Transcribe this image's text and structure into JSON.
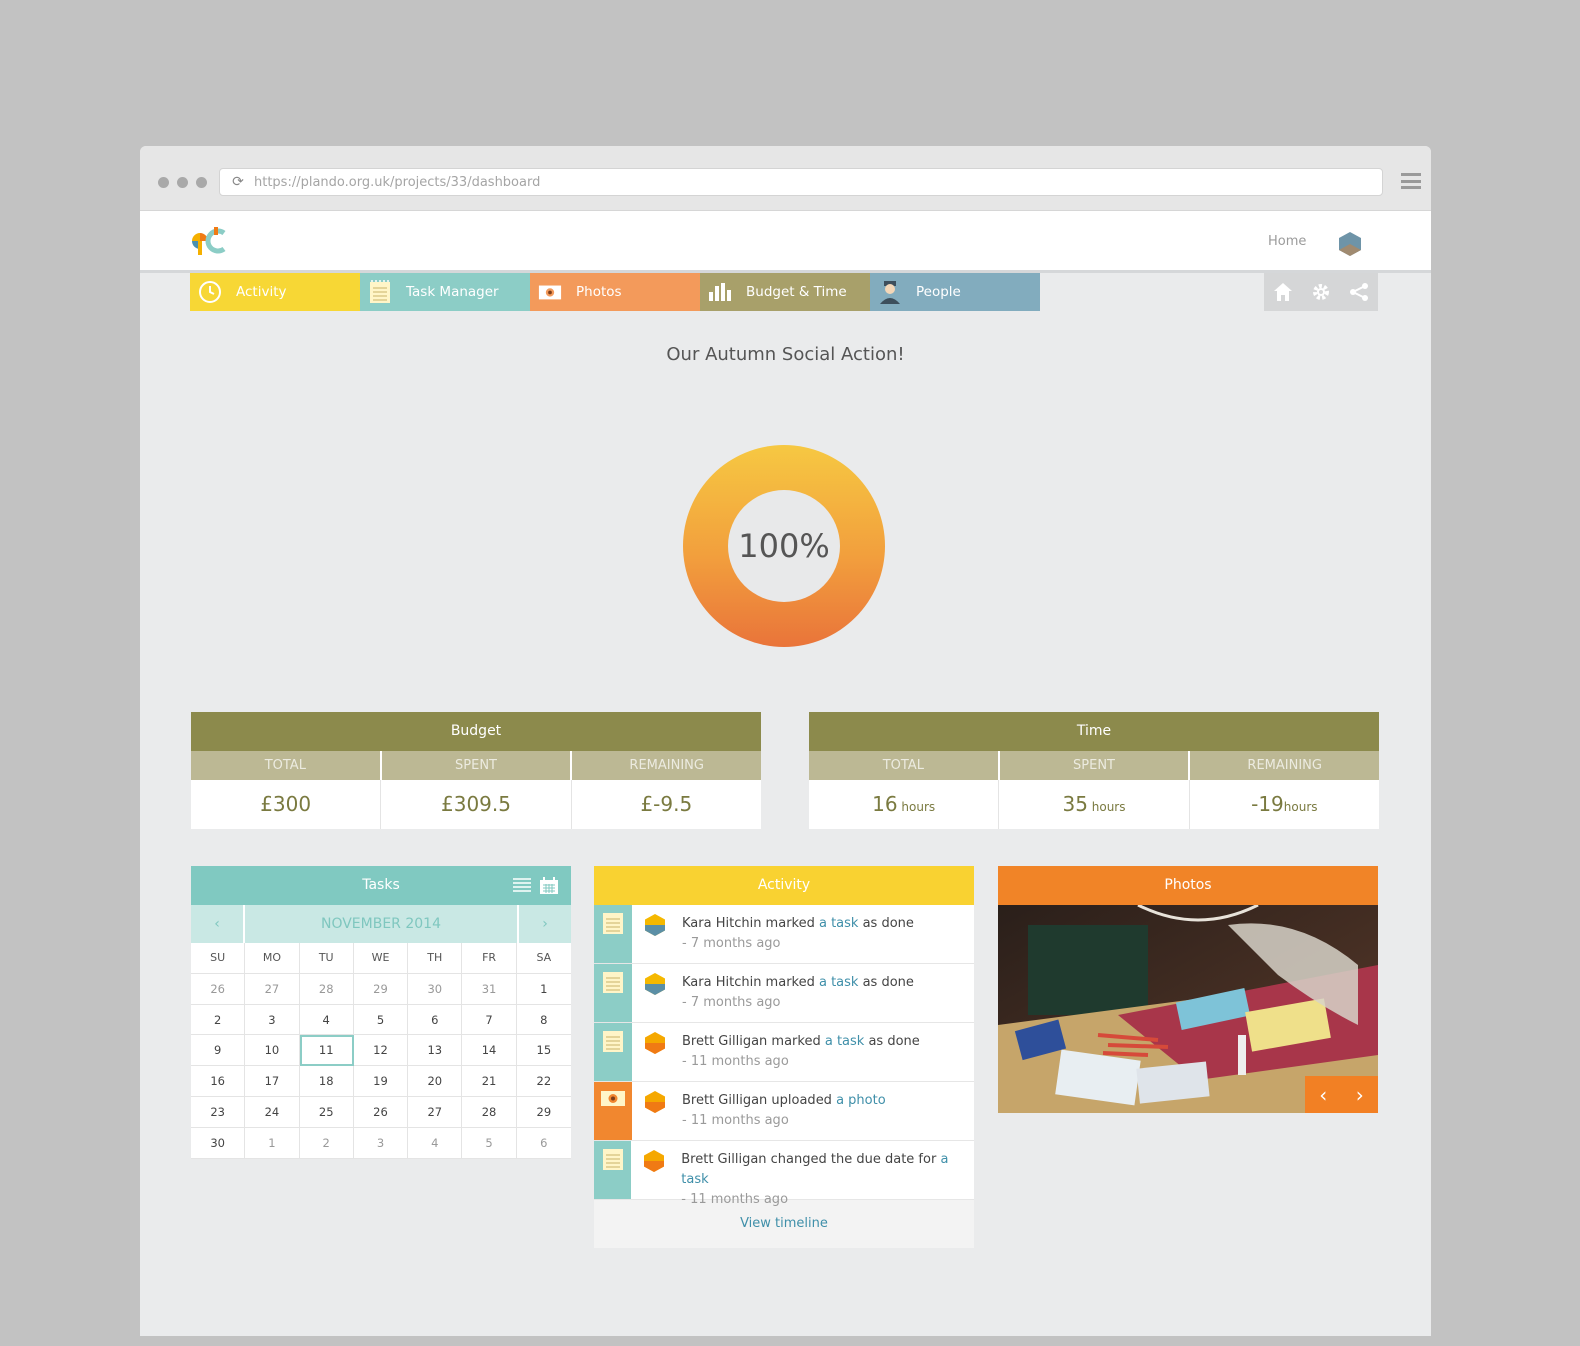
{
  "browser": {
    "url": "https://plando.org.uk/projects/33/dashboard"
  },
  "header": {
    "home_label": "Home"
  },
  "tabs": [
    {
      "label": "Activity",
      "icon": "clock-icon",
      "color": "#f7d735"
    },
    {
      "label": "Task Manager",
      "icon": "notepad-icon",
      "color": "#8ccdc6"
    },
    {
      "label": "Photos",
      "icon": "camera-icon",
      "color": "#f39a5b"
    },
    {
      "label": "Budget & Time",
      "icon": "bar-chart-icon",
      "color": "#a8a06a"
    },
    {
      "label": "People",
      "icon": "person-icon",
      "color": "#82acbe"
    }
  ],
  "tools": [
    "home-icon",
    "gear-icon",
    "share-icon"
  ],
  "project": {
    "title": "Our Autumn Social Action!",
    "progress_label": "100%",
    "progress": 1.0
  },
  "budget": {
    "title": "Budget",
    "headers": [
      "TOTAL",
      "SPENT",
      "REMAINING"
    ],
    "values": [
      "£300",
      "£309.5",
      "£-9.5"
    ]
  },
  "time": {
    "title": "Time",
    "headers": [
      "TOTAL",
      "SPENT",
      "REMAINING"
    ],
    "values": [
      "16",
      "35",
      "-19"
    ],
    "units": [
      " hours",
      " hours",
      "hours"
    ]
  },
  "tasks": {
    "title": "Tasks",
    "month": "NOVEMBER 2014",
    "prev": "‹",
    "next": "›",
    "days_of_week": [
      "SU",
      "MO",
      "TU",
      "WE",
      "TH",
      "FR",
      "SA"
    ],
    "weeks": [
      [
        "26",
        "27",
        "28",
        "29",
        "30",
        "31",
        "1"
      ],
      [
        "2",
        "3",
        "4",
        "5",
        "6",
        "7",
        "8"
      ],
      [
        "9",
        "10",
        "11",
        "12",
        "13",
        "14",
        "15"
      ],
      [
        "16",
        "17",
        "18",
        "19",
        "20",
        "21",
        "22"
      ],
      [
        "23",
        "24",
        "25",
        "26",
        "27",
        "28",
        "29"
      ],
      [
        "30",
        "1",
        "2",
        "3",
        "4",
        "5",
        "6"
      ]
    ],
    "today": "11"
  },
  "activity": {
    "title": "Activity",
    "items": [
      {
        "type": "task",
        "avatar_colors": [
          "#f5b800",
          "#5b8fa6"
        ],
        "before": "Kara Hitchin marked ",
        "link": "a task",
        "after": " as done",
        "ago": "- 7 months ago"
      },
      {
        "type": "task",
        "avatar_colors": [
          "#f5b800",
          "#5b8fa6"
        ],
        "before": "Kara Hitchin marked ",
        "link": "a task",
        "after": " as done",
        "ago": "- 7 months ago"
      },
      {
        "type": "task",
        "avatar_colors": [
          "#f5a800",
          "#f07a14"
        ],
        "before": "Brett Gilligan marked ",
        "link": "a task",
        "after": " as done",
        "ago": "- 11 months ago"
      },
      {
        "type": "photo",
        "avatar_colors": [
          "#f5a800",
          "#f07a14"
        ],
        "before": "Brett Gilligan uploaded ",
        "link": "a photo",
        "after": "",
        "ago": "- 11 months ago"
      },
      {
        "type": "task",
        "avatar_colors": [
          "#f5a800",
          "#f07a14"
        ],
        "before": "Brett Gilligan changed the due date for ",
        "link": "a task",
        "after": "",
        "ago": " - 11 months ago"
      }
    ],
    "footer": "View timeline"
  },
  "photos": {
    "title": "Photos",
    "prev": "‹",
    "next": "›"
  }
}
